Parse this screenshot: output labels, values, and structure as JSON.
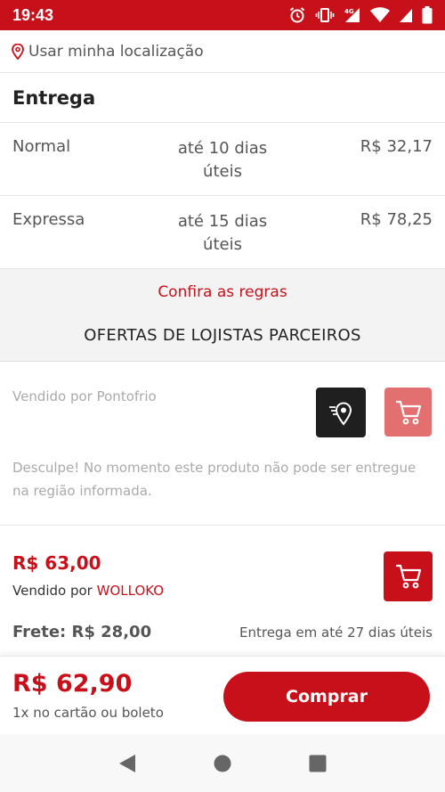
{
  "status_bar": {
    "time": "19:43",
    "network": "4G"
  },
  "location": {
    "label": "Usar minha localização"
  },
  "delivery": {
    "title": "Entrega",
    "options": [
      {
        "name": "Normal",
        "eta_line1": "até 10 dias",
        "eta_line2": "úteis",
        "price": "R$ 32,17"
      },
      {
        "name": "Expressa",
        "eta_line1": "até 15 dias",
        "eta_line2": "úteis",
        "price": "R$ 78,25"
      }
    ]
  },
  "rules": {
    "link": "Confira as regras"
  },
  "offers": {
    "title": "OFERTAS DE LOJISTAS PARCEIROS",
    "seller1": {
      "sold_by": "Vendido por Pontofrio",
      "message": "Desculpe! No momento este produto não pode ser entregue na região informada."
    },
    "seller2": {
      "price": "R$ 63,00",
      "sold_by_prefix": "Vendido por",
      "seller_name": "WOLLOKO",
      "freight": "Frete: R$ 28,00",
      "delivery": "Entrega em até 27 dias úteis"
    }
  },
  "buy_bar": {
    "total": "R$ 62,90",
    "terms": "1x no cartão ou boleto",
    "button": "Comprar"
  },
  "colors": {
    "brand": "#c8101a",
    "disabled_cart": "#e27070"
  }
}
